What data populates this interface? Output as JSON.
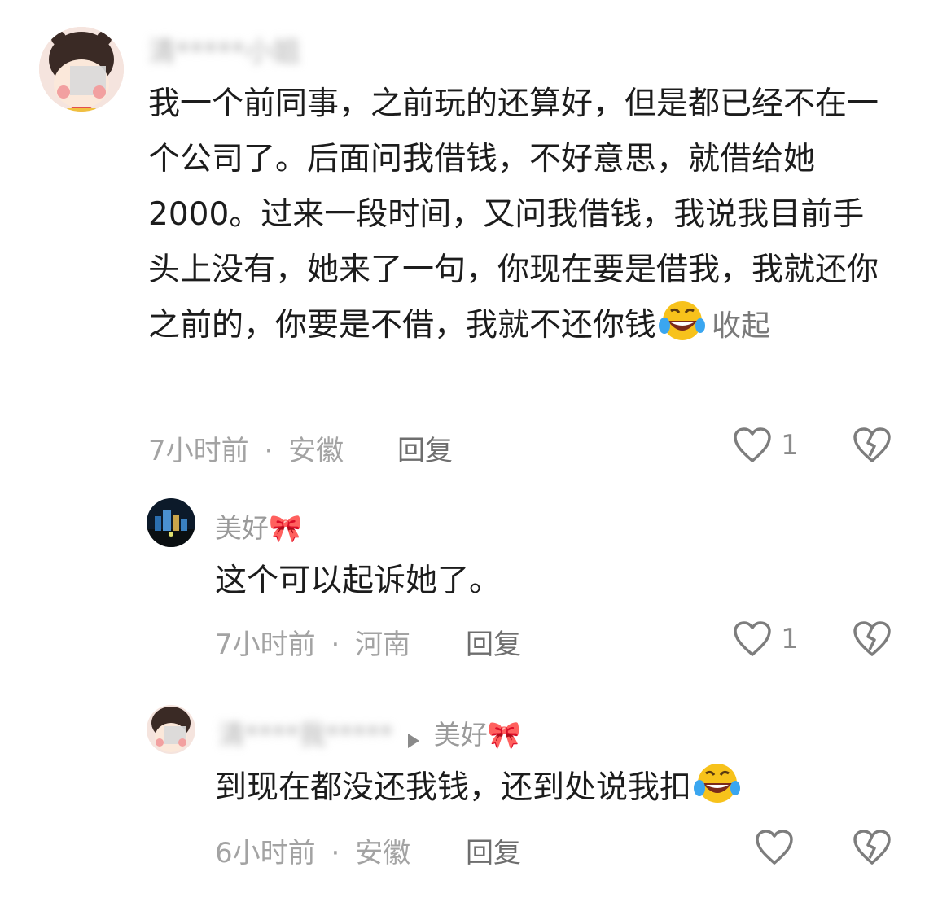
{
  "comments": [
    {
      "author": "清*****小姐",
      "text": "我一个前同事，之前玩的还算好，但是都已经不在一个公司了。后面问我借钱，不好意思，就借给她2000。过来一段时间，又问我借钱，我说我目前手头上没有，她来了一句，你现在要是借我，我就还你之前的，你要是不借，我就不还你钱",
      "collapse": "收起",
      "time": "7小时前",
      "location": "安徽",
      "reply": "回复",
      "likes": "1"
    },
    {
      "author": "美好🎀",
      "text": "这个可以起诉她了。",
      "time": "7小时前",
      "location": "河南",
      "reply": "回复",
      "likes": "1"
    },
    {
      "author": "清****我*****",
      "reply_to": "美好🎀",
      "text": "到现在都没还我钱，还到处说我扣",
      "time": "6小时前",
      "location": "安徽",
      "reply": "回复",
      "likes": ""
    }
  ],
  "separator": "·",
  "icons": {
    "like": "heart-outline-icon",
    "dislike": "broken-heart-icon",
    "emoji": "laughing-tears-emoji",
    "arrow": "play-triangle-icon"
  },
  "colors": {
    "muted": "#9c9c9c",
    "text": "#1c1c1c"
  }
}
